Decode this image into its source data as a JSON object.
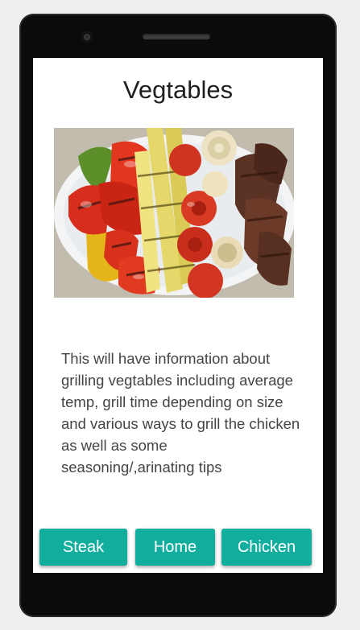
{
  "page": {
    "title": "Vegtables",
    "description": "This will have information about grilling vegtables including average temp, grill time depending on size and various ways to grill the chicken as well as some seasoning/,arinating tips"
  },
  "image": {
    "alt": "grilled-vegetables-photo"
  },
  "buttons": {
    "steak": "Steak",
    "home": "Home",
    "chicken": "Chicken"
  },
  "colors": {
    "button": "#12ae9d",
    "screen": "#ffffff",
    "device": "#0b0b0b"
  }
}
